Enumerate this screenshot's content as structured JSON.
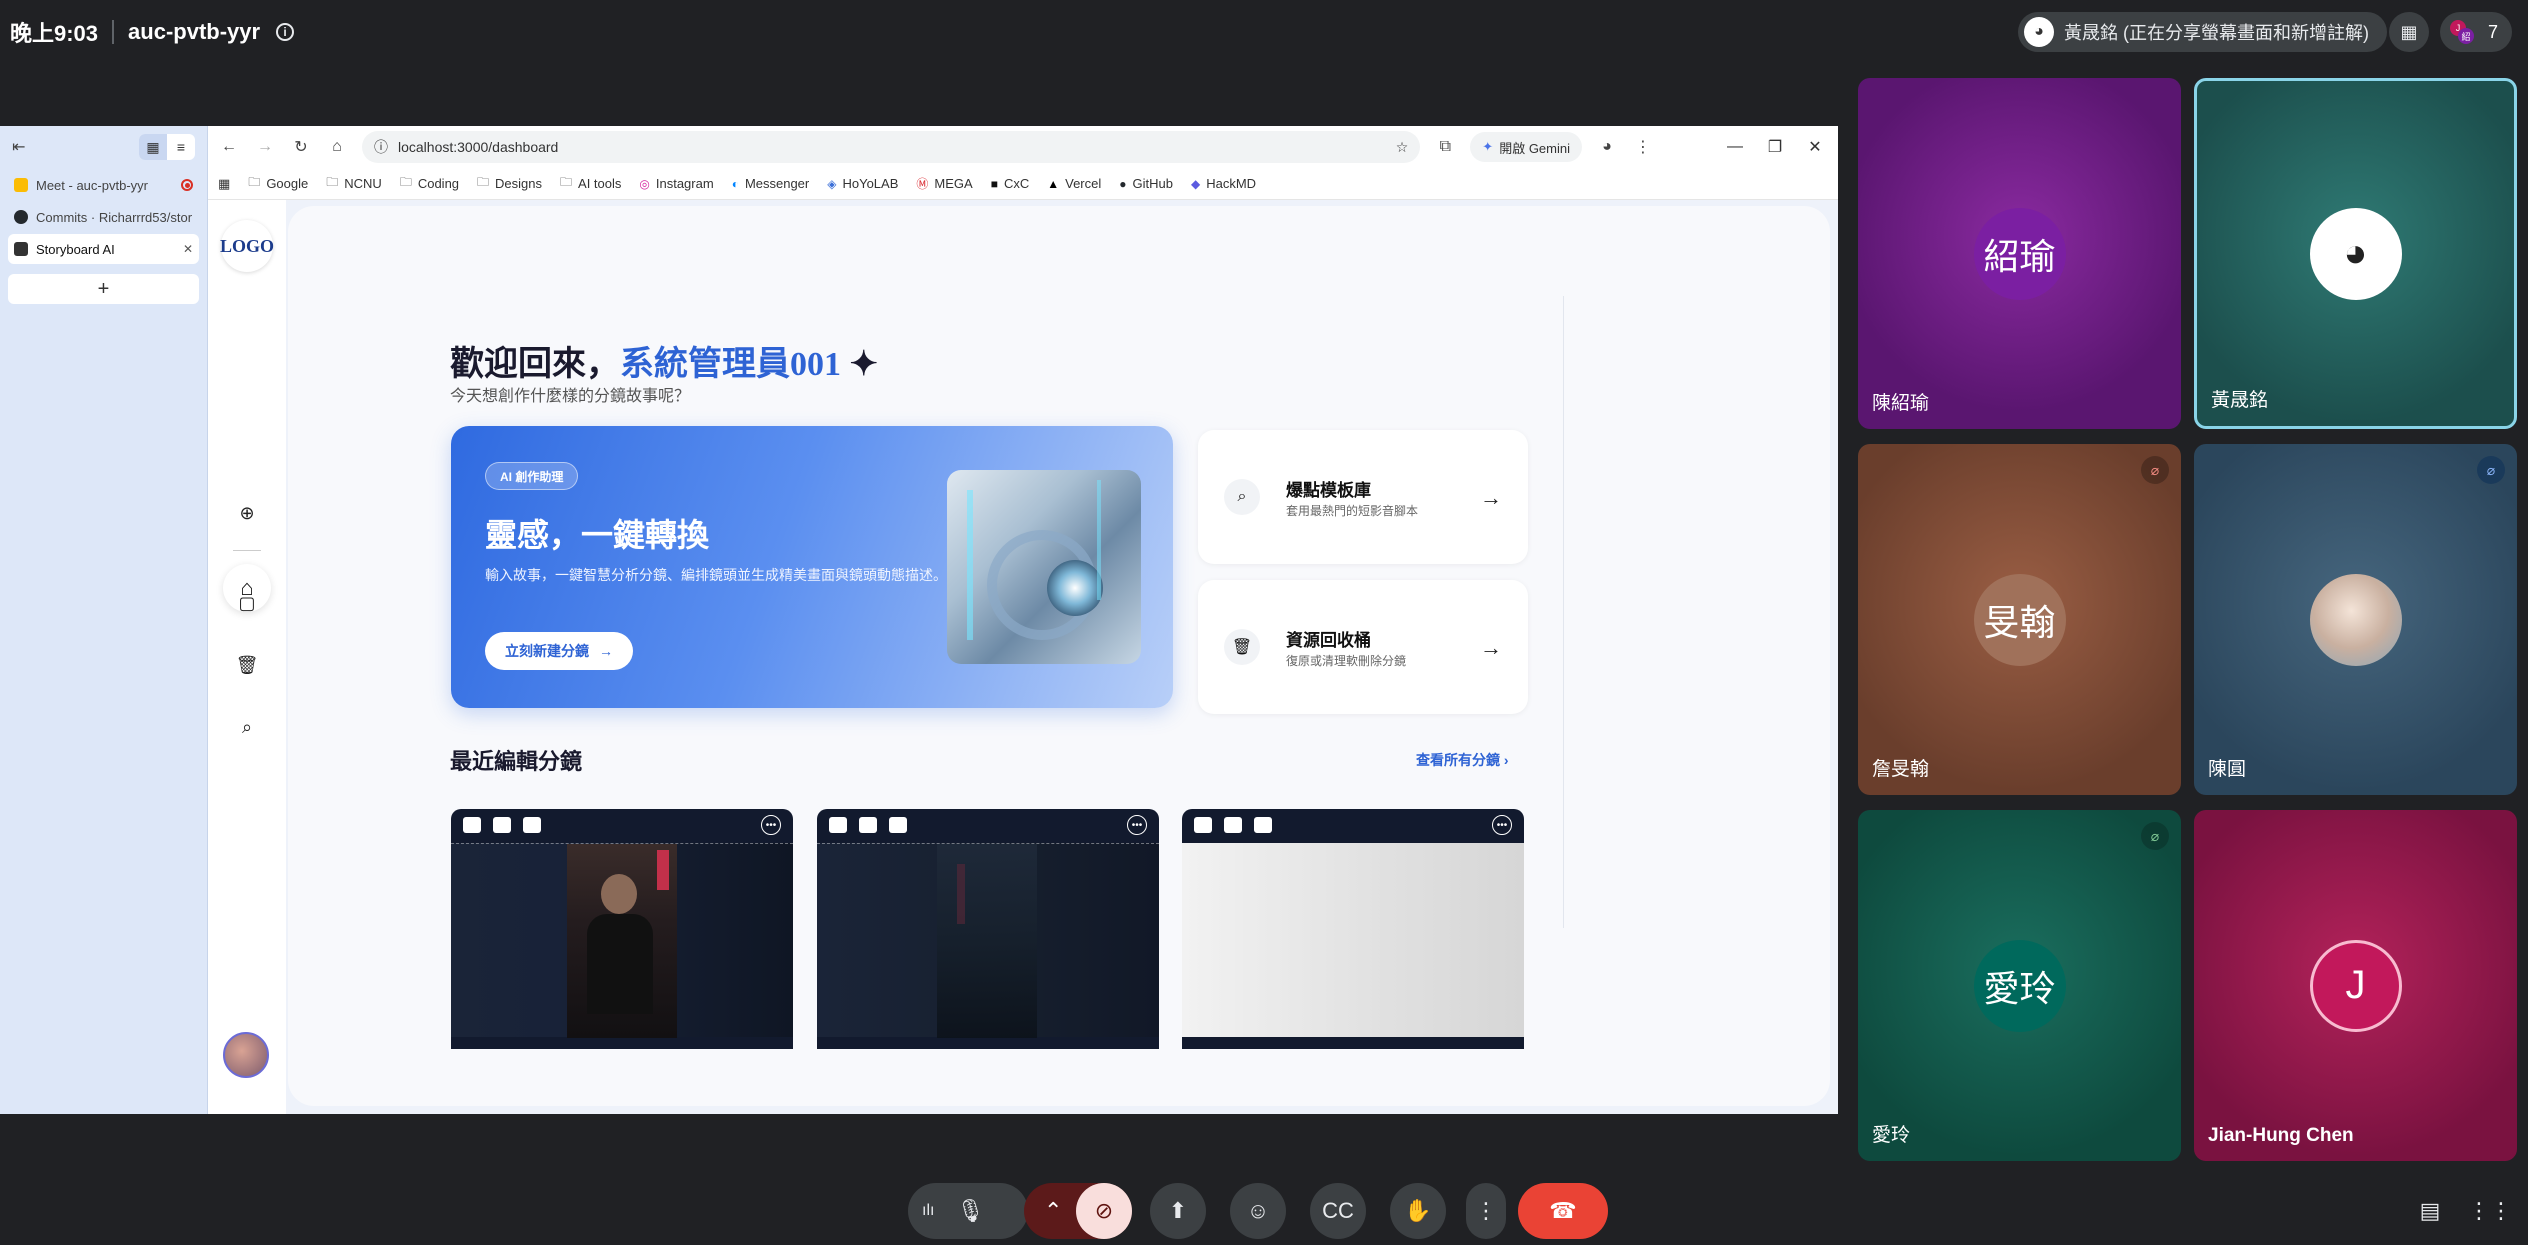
{
  "meet": {
    "time": "晚上9:03",
    "code": "auc-pvtb-yyr",
    "presenter_chip": "黃晟銘 (正在分享螢幕畫面和新增註解)",
    "people_count": "7"
  },
  "browser": {
    "tabs": [
      {
        "title": "Meet - auc-pvtb-yyr",
        "favicon": "meet-icon"
      },
      {
        "title": "Commits · Richarrrd53/stor",
        "favicon": "github-icon"
      },
      {
        "title": "Storyboard AI",
        "favicon": "clapperboard-icon",
        "active": true
      }
    ],
    "url": "localhost:3000/dashboard",
    "gemini_label": "開啟 Gemini",
    "bookmarks": [
      {
        "label": "Google",
        "icon": "folder-icon"
      },
      {
        "label": "NCNU",
        "icon": "folder-icon"
      },
      {
        "label": "Coding",
        "icon": "folder-icon"
      },
      {
        "label": "Designs",
        "icon": "folder-icon"
      },
      {
        "label": "AI tools",
        "icon": "folder-icon"
      },
      {
        "label": "Instagram",
        "icon": "instagram-icon"
      },
      {
        "label": "Messenger",
        "icon": "messenger-icon"
      },
      {
        "label": "HoYoLAB",
        "icon": "hoyolab-icon"
      },
      {
        "label": "MEGA",
        "icon": "mega-icon"
      },
      {
        "label": "CxC",
        "icon": "cxc-icon"
      },
      {
        "label": "Vercel",
        "icon": "vercel-icon"
      },
      {
        "label": "GitHub",
        "icon": "github-icon"
      },
      {
        "label": "HackMD",
        "icon": "hackmd-icon"
      }
    ]
  },
  "app": {
    "logo": "LOGO",
    "welcome_prefix": "歡迎回來，",
    "welcome_user": "系統管理員001",
    "welcome_sub": "今天想創作什麼樣的分鏡故事呢？",
    "hero": {
      "badge": "AI 創作助理",
      "title": "靈感，一鍵轉換",
      "desc": "輸入故事，一鍵智慧分析分鏡、編排鏡頭並生成精美畫面與鏡頭動態描述。",
      "button": "立刻新建分鏡"
    },
    "cards": [
      {
        "title": "爆點模板庫",
        "desc": "套用最熱門的短影音腳本",
        "icon": "search-icon"
      },
      {
        "title": "資源回收桶",
        "desc": "復原或清理軟刪除分鏡",
        "icon": "trash-icon"
      }
    ],
    "recent_title": "最近編輯分鏡",
    "view_all": "查看所有分鏡",
    "accent": "#2e63d4"
  },
  "participants": [
    {
      "name": "陳紹瑜",
      "initials": "紹瑜",
      "bg": "#6a1b8a",
      "avatar_bg": "#7b1fa2"
    },
    {
      "name": "黃晟銘",
      "initials": "",
      "bg": "#1e5a58",
      "avatar_bg": "#ffffff",
      "active_speaker": true
    },
    {
      "name": "詹旻翰",
      "initials": "旻翰",
      "bg": "#7a4a34",
      "avatar_bg": "#a0715a",
      "muted": true
    },
    {
      "name": "陳圓",
      "initials": "",
      "bg": "#2e4a62",
      "avatar_bg": "#d8c7bb",
      "muted": true
    },
    {
      "name": "愛玲",
      "initials": "愛玲",
      "bg": "#0f5548",
      "avatar_bg": "#00695c",
      "muted": true
    },
    {
      "name": "Jian-Hung Chen",
      "initials": "J",
      "bg": "#9c1a4e",
      "avatar_bg": "#c2185b"
    }
  ]
}
